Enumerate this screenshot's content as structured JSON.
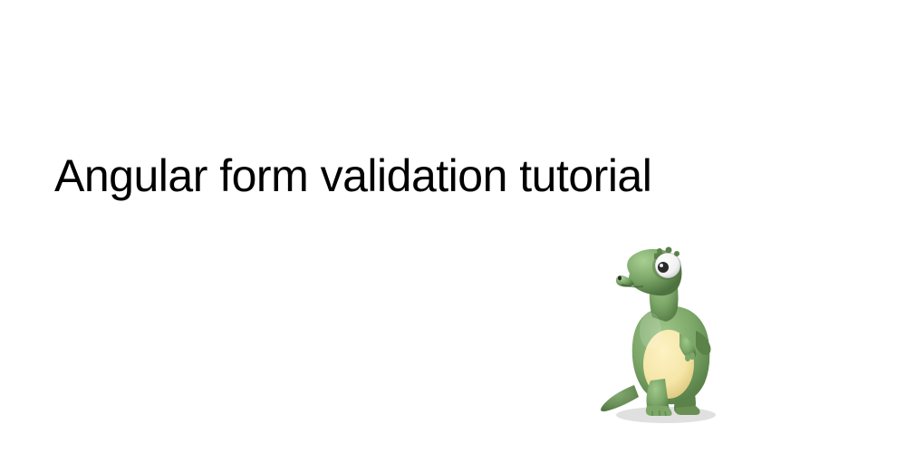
{
  "title": "Angular form validation tutorial",
  "mascot": {
    "name": "dinosaur-mascot",
    "colors": {
      "body": "#7ba668",
      "bodyDark": "#5a8249",
      "bodyLight": "#96c082",
      "belly": "#f5e6a8",
      "bellyDark": "#e8d688",
      "eye": "#f8f8f8",
      "pupil": "#2a2a2a",
      "nostril": "#3a3a3a"
    }
  }
}
